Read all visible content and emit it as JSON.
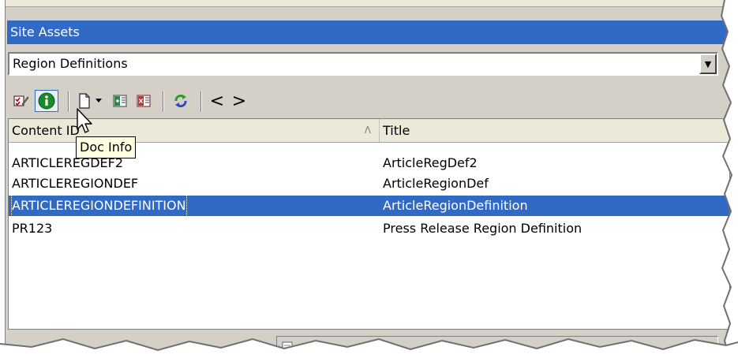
{
  "panel": {
    "title": "Site Assets"
  },
  "dropdown": {
    "selected": "Region Definitions"
  },
  "toolbar": {
    "buttons": [
      {
        "icon": "checklist-edit-icon"
      },
      {
        "icon": "info-icon"
      },
      {
        "icon": "new-document-icon"
      },
      {
        "icon": "dropdown-arrow-icon"
      },
      {
        "icon": "add-to-list-icon"
      },
      {
        "icon": "remove-from-list-icon"
      },
      {
        "icon": "refresh-icon"
      },
      {
        "icon": "back-icon",
        "label": "<"
      },
      {
        "icon": "forward-icon",
        "label": ">"
      }
    ]
  },
  "table": {
    "columns": [
      "Content ID",
      "Title"
    ],
    "rows": [
      {
        "content_id": "ARTICLEREGDEF2",
        "title": "ArticleRegDef2"
      },
      {
        "content_id": "ARTICLEREGIONDEF",
        "title": "ArticleRegionDef"
      },
      {
        "content_id": "ARTICLEREGIONDEFINITION",
        "title": "ArticleRegionDefinition",
        "selected": true
      },
      {
        "content_id": "PR123",
        "title": "Press Release Region Definition"
      }
    ],
    "sort_indicator": "Λ"
  },
  "tooltip": "Doc Info",
  "colors": {
    "selection": "#316ac5",
    "titlebar": "#316ac5",
    "panel": "#d4d0c8",
    "tooltip": "#ffffe1"
  }
}
